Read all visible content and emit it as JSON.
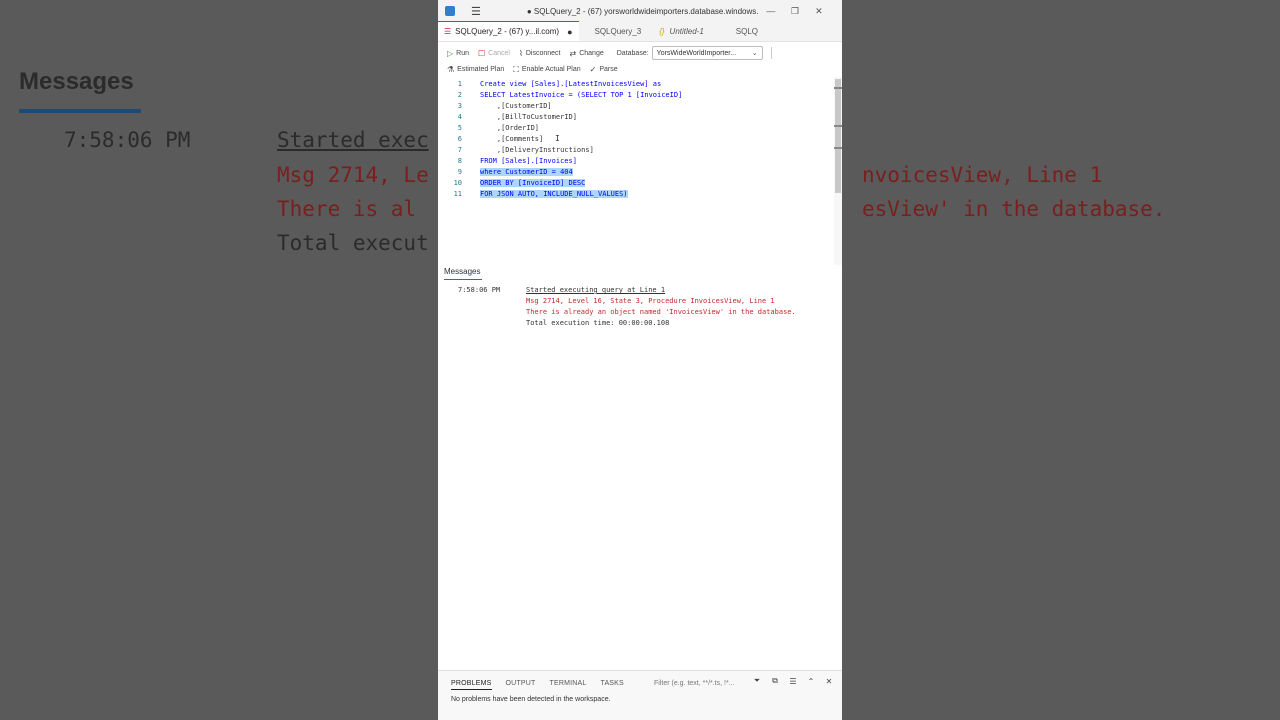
{
  "background": {
    "title": "Messages",
    "time": "7:58:06 PM",
    "started": "Started exec",
    "err1": "Msg 2714, Le",
    "err2": "There is al",
    "total": "Total execut",
    "right1": "nvoicesView, Line 1",
    "right2": "esView' in the database."
  },
  "window": {
    "title": "● SQLQuery_2 - (67) yorsworldwideimporters.database.windows....",
    "minimize": "—",
    "restore": "❐",
    "close": "✕"
  },
  "tabs": [
    {
      "label": "SQLQuery_2 - (67) y...il.com)",
      "dot": "●"
    },
    {
      "label": "SQLQuery_3"
    },
    {
      "label": "Untitled-1"
    },
    {
      "label": "SQLQ"
    }
  ],
  "toolbar": {
    "run": "Run",
    "cancel": "Cancel",
    "disconnect": "Disconnect",
    "change": "Change",
    "database_label": "Database:",
    "database_value": "YorsWideWorldImporter...",
    "estimated_plan": "Estimated Plan",
    "enable_actual_plan": "Enable Actual Plan",
    "parse": "Parse"
  },
  "editor": {
    "lines": [
      {
        "n": "1",
        "code": "Create view [Sales].[LatestInvoicesView] as"
      },
      {
        "n": "2",
        "code": "SELECT LatestInvoice = (SELECT TOP 1 [InvoiceID]"
      },
      {
        "n": "3",
        "code": "    ,[CustomerID]"
      },
      {
        "n": "4",
        "code": "    ,[BillToCustomerID]"
      },
      {
        "n": "5",
        "code": "    ,[OrderID]"
      },
      {
        "n": "6",
        "code": "    ,[Comments]"
      },
      {
        "n": "7",
        "code": "    ,[DeliveryInstructions]"
      },
      {
        "n": "8",
        "code": "FROM [Sales].[Invoices]"
      },
      {
        "n": "9",
        "code": "where CustomerID = 404"
      },
      {
        "n": "10",
        "code": "ORDER BY [InvoiceID] DESC"
      },
      {
        "n": "11",
        "code": "FOR JSON AUTO, INCLUDE_NULL_VALUES)"
      }
    ]
  },
  "messages": {
    "header": "Messages",
    "time": "7:58:06 PM",
    "started": "Started executing query at Line 1",
    "err1": "Msg 2714, Level 16, State 3, Procedure InvoicesView, Line 1",
    "err2": "There is already an object named 'InvoicesView' in the database.",
    "total": "Total execution time: 00:00:00.108"
  },
  "panel": {
    "tabs": [
      "PROBLEMS",
      "OUTPUT",
      "TERMINAL",
      "TASKS"
    ],
    "filter_placeholder": "Filter (e.g. text, **/*.ts, !*...",
    "message": "No problems have been detected in the workspace."
  }
}
